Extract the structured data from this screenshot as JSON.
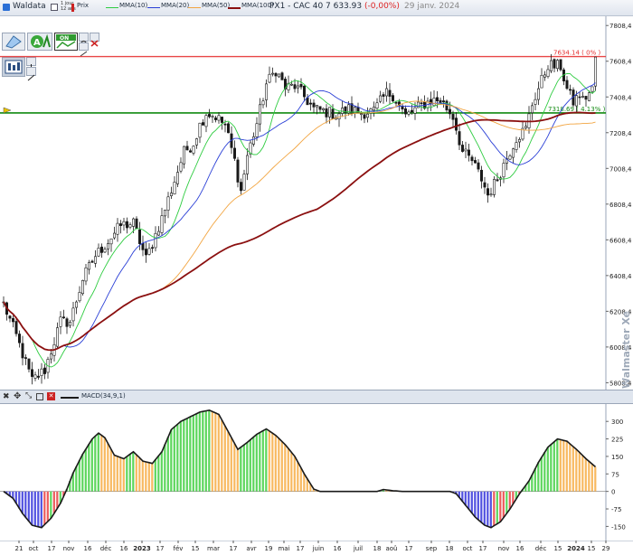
{
  "window": {
    "app_name": "Waldata",
    "period_1": "1 jour",
    "period_2": "12 ans",
    "prix_label": "Prix"
  },
  "header": {
    "title": "PX1 - CAC 40",
    "price": "7 633.93",
    "change": "(-0,00%)",
    "date": "29 janv. 2024"
  },
  "legend": [
    {
      "label": "MMA(10)",
      "color": "#2ecc40"
    },
    {
      "label": "MMA(20)",
      "color": "#2a3fd6"
    },
    {
      "label": "MMA(50)",
      "color": "#f2a541"
    },
    {
      "label": "MMA(100)",
      "color": "#8b1010"
    }
  ],
  "indicator_label": "MACD(34,9,1)",
  "watermark": "Walmaster Xe",
  "toolbar_icons": [
    "pointer-icon",
    "fibonacci-icon",
    "on-toggle-icon",
    "settings-icon",
    "delete-icon",
    "candle-chart-icon",
    "crosshair-icon",
    "zoom-icon"
  ],
  "chart_data": [
    {
      "type": "candlestick",
      "title": "PX1 - CAC 40",
      "y_ticks": [
        "7808,4",
        "7608,4",
        "7408,4",
        "7208,4",
        "7008,4",
        "6808,4",
        "6608,4",
        "6408,4",
        "6208,4",
        "6008,4",
        "5808,4"
      ],
      "ylim": [
        5770,
        7850
      ],
      "x_ticks": [
        "21",
        "oct",
        "17",
        "nov",
        "16",
        "déc",
        "16",
        "2023",
        "17",
        "fév",
        "15",
        "mar",
        "17",
        "avr",
        "19",
        "mai",
        "17",
        "juin",
        "16",
        "juil",
        "18",
        "aoû",
        "17",
        "sep",
        "18",
        "oct",
        "17",
        "nov",
        "16",
        "déc",
        "15",
        "2024",
        "15",
        "29"
      ],
      "price_path": [
        [
          0,
          6250
        ],
        [
          4,
          6070
        ],
        [
          9,
          5820
        ],
        [
          13,
          5880
        ],
        [
          18,
          6150
        ],
        [
          21,
          6150
        ],
        [
          25,
          6390
        ],
        [
          29,
          6520
        ],
        [
          33,
          6600
        ],
        [
          37,
          6690
        ],
        [
          41,
          6700
        ],
        [
          45,
          6500
        ],
        [
          50,
          6730
        ],
        [
          54,
          6940
        ],
        [
          57,
          7100
        ],
        [
          60,
          7150
        ],
        [
          62,
          7250
        ],
        [
          64,
          7320
        ],
        [
          67,
          7300
        ],
        [
          70,
          7250
        ],
        [
          73,
          7050
        ],
        [
          75,
          6880
        ],
        [
          77,
          7080
        ],
        [
          80,
          7260
        ],
        [
          83,
          7480
        ],
        [
          86,
          7560
        ],
        [
          89,
          7460
        ],
        [
          92,
          7470
        ],
        [
          95,
          7410
        ],
        [
          98,
          7340
        ],
        [
          101,
          7330
        ],
        [
          105,
          7310
        ],
        [
          109,
          7340
        ],
        [
          113,
          7320
        ],
        [
          117,
          7330
        ],
        [
          121,
          7430
        ],
        [
          123,
          7420
        ],
        [
          127,
          7300
        ],
        [
          131,
          7350
        ],
        [
          135,
          7390
        ],
        [
          138,
          7390
        ],
        [
          142,
          7300
        ],
        [
          145,
          7100
        ],
        [
          148,
          7050
        ],
        [
          151,
          6950
        ],
        [
          153,
          6860
        ],
        [
          156,
          6950
        ],
        [
          159,
          7070
        ],
        [
          162,
          7180
        ],
        [
          165,
          7230
        ],
        [
          167,
          7370
        ],
        [
          170,
          7500
        ],
        [
          172,
          7590
        ],
        [
          174,
          7580
        ],
        [
          176,
          7580
        ],
        [
          178,
          7450
        ],
        [
          180,
          7380
        ],
        [
          182,
          7420
        ],
        [
          183,
          7390
        ],
        [
          186,
          7450
        ],
        [
          187,
          7630
        ]
      ],
      "resistance": 7634.14,
      "resistance_label": "7634.14 ( 0% )",
      "support": 7318.69,
      "support_label": "7318.69 ( 4.13% )"
    },
    {
      "type": "bar",
      "title": "MACD(34,9,1)",
      "y_ticks": [
        "300",
        "225",
        "150",
        "75",
        "0",
        "-75",
        "-150"
      ],
      "ylim": [
        -195,
        355
      ],
      "macd_path": [
        [
          0,
          0
        ],
        [
          3,
          -30
        ],
        [
          6,
          -95
        ],
        [
          9,
          -145
        ],
        [
          12,
          -155
        ],
        [
          15,
          -115
        ],
        [
          18,
          -50
        ],
        [
          20,
          10
        ],
        [
          22,
          80
        ],
        [
          25,
          160
        ],
        [
          28,
          225
        ],
        [
          30,
          250
        ],
        [
          32,
          230
        ],
        [
          35,
          155
        ],
        [
          38,
          140
        ],
        [
          41,
          170
        ],
        [
          44,
          130
        ],
        [
          47,
          120
        ],
        [
          50,
          170
        ],
        [
          53,
          265
        ],
        [
          56,
          300
        ],
        [
          59,
          320
        ],
        [
          62,
          340
        ],
        [
          65,
          348
        ],
        [
          68,
          330
        ],
        [
          71,
          255
        ],
        [
          74,
          180
        ],
        [
          77,
          210
        ],
        [
          80,
          245
        ],
        [
          83,
          268
        ],
        [
          86,
          240
        ],
        [
          89,
          200
        ],
        [
          92,
          150
        ],
        [
          95,
          75
        ],
        [
          98,
          10
        ],
        [
          100,
          0
        ],
        [
          118,
          0
        ],
        [
          120,
          8
        ],
        [
          123,
          3
        ],
        [
          126,
          0
        ],
        [
          141,
          0
        ],
        [
          143,
          -10
        ],
        [
          146,
          -60
        ],
        [
          149,
          -110
        ],
        [
          152,
          -145
        ],
        [
          154,
          -155
        ],
        [
          157,
          -130
        ],
        [
          160,
          -75
        ],
        [
          163,
          -10
        ],
        [
          166,
          45
        ],
        [
          169,
          125
        ],
        [
          172,
          190
        ],
        [
          175,
          225
        ],
        [
          178,
          215
        ],
        [
          181,
          180
        ],
        [
          184,
          140
        ],
        [
          187,
          105
        ]
      ],
      "signal_lag": 4
    }
  ]
}
